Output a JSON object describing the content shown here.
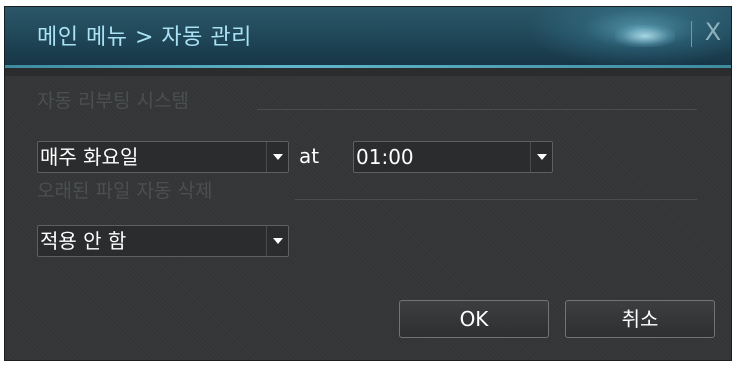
{
  "window": {
    "title": "메인 메뉴 > 자동 관리",
    "close_label": "X"
  },
  "reboot": {
    "section_label": "자동 리부팅 시스템",
    "day_value": "매주 화요일",
    "at_label": "at",
    "time_value": "01:00"
  },
  "delete": {
    "section_label": "오래된 파일 자동 삭제",
    "value": "적용 안 함"
  },
  "buttons": {
    "ok_label": "OK",
    "cancel_label": "취소"
  },
  "colors": {
    "title_text": "#a9e2f5",
    "accent_line": "#5fb6cc",
    "panel_bg": "#333536"
  }
}
